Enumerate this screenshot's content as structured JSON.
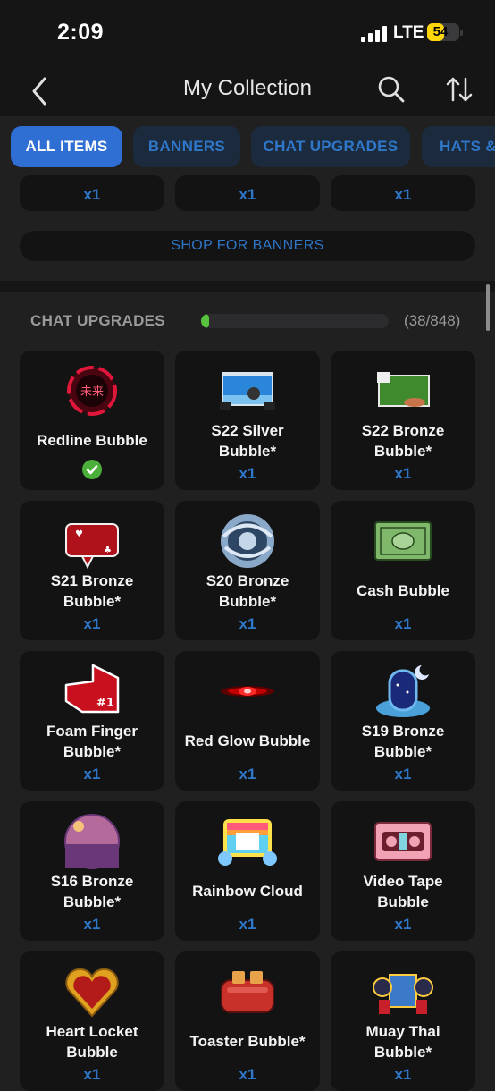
{
  "status": {
    "time": "2:09",
    "network": "LTE",
    "battery": "54"
  },
  "nav": {
    "title": "My Collection",
    "icons": [
      "back-icon",
      "search-icon",
      "sort-icon"
    ]
  },
  "tabs": [
    {
      "label": "ALL ITEMS",
      "active": true
    },
    {
      "label": "BANNERS",
      "active": false
    },
    {
      "label": "CHAT UPGRADES",
      "active": false
    },
    {
      "label": "HATS &",
      "active": false
    }
  ],
  "banners": {
    "quantities": [
      "x1",
      "x1",
      "x1"
    ],
    "shop_label": "SHOP FOR BANNERS"
  },
  "chat_upgrades": {
    "title": "CHAT UPGRADES",
    "count": "(38/848)",
    "progress": 0.045,
    "items": [
      {
        "name": "Redline Bubble",
        "qty": "",
        "equipped": true,
        "icon": "redline-bubble-icon"
      },
      {
        "name": "S22 Silver Bubble*",
        "qty": "x1",
        "icon": "s22-silver-bubble-icon"
      },
      {
        "name": "S22 Bronze Bubble*",
        "qty": "x1",
        "icon": "s22-bronze-bubble-icon"
      },
      {
        "name": "S21 Bronze Bubble*",
        "qty": "x1",
        "icon": "s21-bronze-bubble-icon"
      },
      {
        "name": "S20 Bronze Bubble*",
        "qty": "x1",
        "icon": "s20-bronze-bubble-icon"
      },
      {
        "name": "Cash Bubble",
        "qty": "x1",
        "icon": "cash-bubble-icon"
      },
      {
        "name": "Foam Finger Bubble*",
        "qty": "x1",
        "icon": "foam-finger-bubble-icon"
      },
      {
        "name": "Red Glow Bubble",
        "qty": "x1",
        "icon": "red-glow-bubble-icon"
      },
      {
        "name": "S19 Bronze Bubble*",
        "qty": "x1",
        "icon": "s19-bronze-bubble-icon"
      },
      {
        "name": "S16 Bronze Bubble*",
        "qty": "x1",
        "icon": "s16-bronze-bubble-icon"
      },
      {
        "name": "Rainbow Cloud",
        "qty": "x1",
        "icon": "rainbow-cloud-icon"
      },
      {
        "name": "Video Tape Bubble",
        "qty": "x1",
        "icon": "video-tape-bubble-icon"
      },
      {
        "name": "Heart Locket Bubble",
        "qty": "x1",
        "icon": "heart-locket-bubble-icon"
      },
      {
        "name": "Toaster Bubble*",
        "qty": "x1",
        "icon": "toaster-bubble-icon"
      },
      {
        "name": "Muay Thai Bubble*",
        "qty": "x1",
        "icon": "muay-thai-bubble-icon"
      }
    ]
  },
  "colors": {
    "accent": "#2f6ed2",
    "link": "#2f77c9",
    "progress": "#58c33c",
    "card": "#131314",
    "background": "#202021"
  }
}
